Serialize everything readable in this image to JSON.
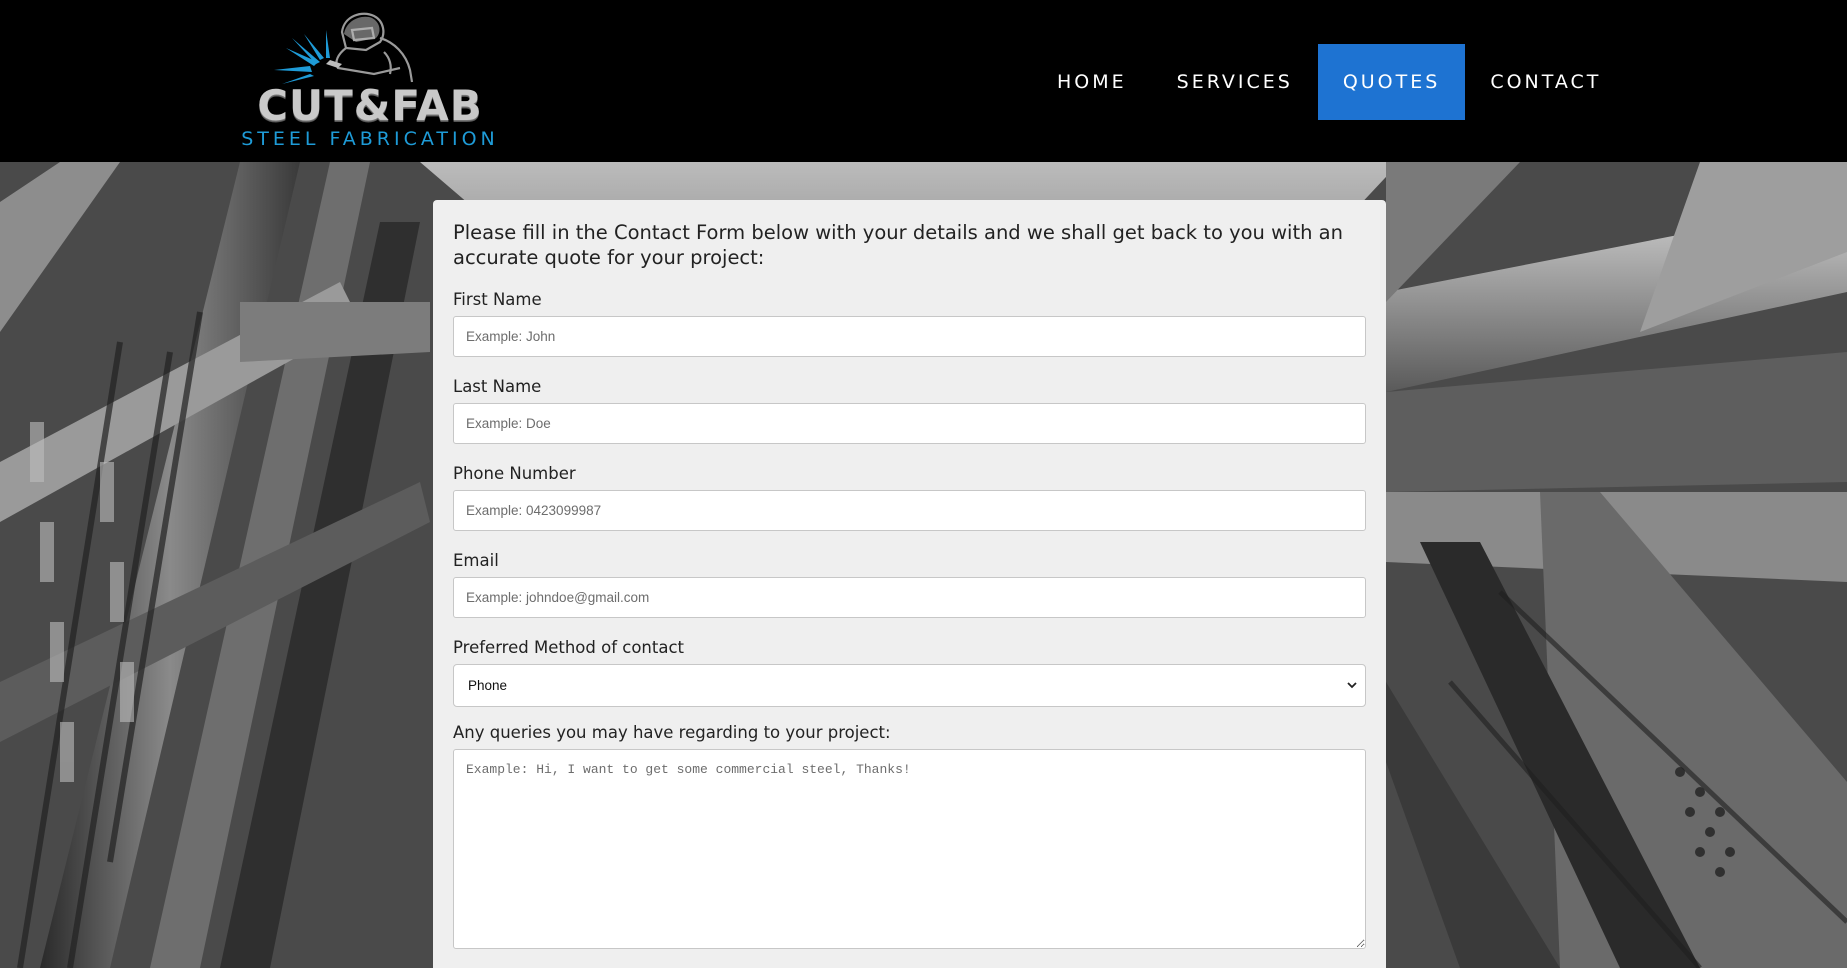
{
  "header": {
    "logo": {
      "brand": "CUT&FAB",
      "tagline": "STEEL FABRICATION"
    },
    "nav": [
      {
        "label": "HOME",
        "active": false
      },
      {
        "label": "SERVICES",
        "active": false
      },
      {
        "label": "QUOTES",
        "active": true
      },
      {
        "label": "CONTACT",
        "active": false
      }
    ]
  },
  "colors": {
    "nav_active": "#1e73d2",
    "logo_accent": "#1e9bd7",
    "header_bg": "#000000",
    "card_bg": "#efefef"
  },
  "form": {
    "intro": "Please fill in the Contact Form below with your details and we shall get back to you with an accurate quote for your project:",
    "first_name": {
      "label": "First Name",
      "placeholder": "Example: John"
    },
    "last_name": {
      "label": "Last Name",
      "placeholder": "Example: Doe"
    },
    "phone": {
      "label": "Phone Number",
      "placeholder": "Example: 0423099987"
    },
    "email": {
      "label": "Email",
      "placeholder": "Example: johndoe@gmail.com"
    },
    "contact_method": {
      "label": "Preferred Method of contact",
      "selected": "Phone"
    },
    "queries": {
      "label": "Any queries you may have regarding to your project:",
      "placeholder": "Example: Hi, I want to get some commercial steel, Thanks!"
    }
  }
}
